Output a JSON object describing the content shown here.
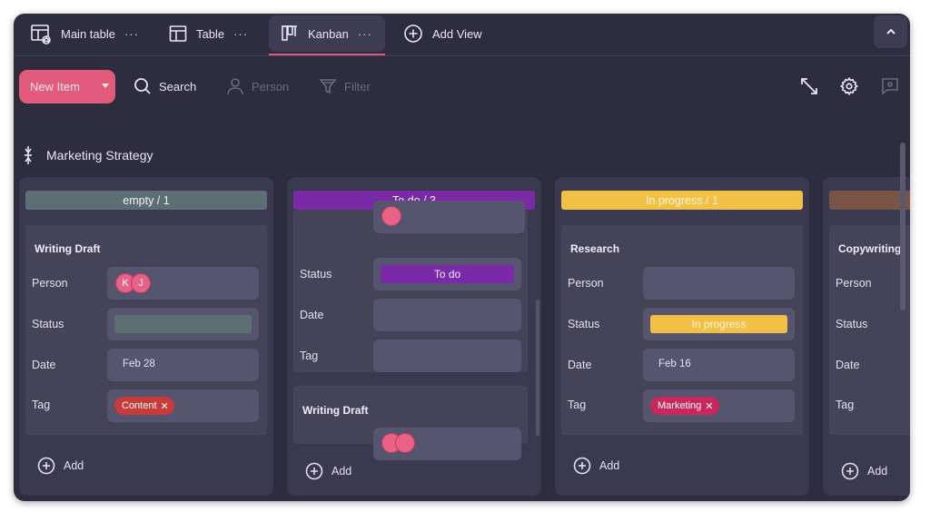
{
  "tabs": [
    {
      "label": "Main table",
      "icon": "table-home-icon",
      "dots": "···"
    },
    {
      "label": "Table",
      "icon": "table-icon",
      "dots": "···"
    },
    {
      "label": "Kanban",
      "icon": "kanban-icon",
      "dots": "···",
      "active": true
    }
  ],
  "add_view": {
    "label": "Add View",
    "icon": "plus-circle-icon"
  },
  "toolbar": {
    "new_item_label": "New Item",
    "search_label": "Search",
    "person_label": "Person",
    "filter_label": "Filter"
  },
  "board": {
    "title": "Marketing Strategy"
  },
  "labels": {
    "person": "Person",
    "status": "Status",
    "date": "Date",
    "tag": "Tag",
    "add": "Add"
  },
  "columns": [
    {
      "header": "empty / 1",
      "header_color": "#5c7073",
      "card": {
        "title": "Writing Draft",
        "avatars": [
          "K",
          "J"
        ],
        "status_color": "#5c7073",
        "date": "Feb 28",
        "tag": "Content",
        "tag_color": "#c93a3a"
      }
    },
    {
      "header": "To do / 3",
      "header_color": "#7a2aa6",
      "card": {
        "status": "To do",
        "status_color": "#7a2aa6"
      },
      "card2": {
        "title": "Writing Draft"
      }
    },
    {
      "header": "In progress / 1",
      "header_color": "#f1c044",
      "card": {
        "title": "Research",
        "status": "In progress",
        "status_color": "#f1c044",
        "date": "Feb 16",
        "tag": "Marketing",
        "tag_color": "#c9275a"
      }
    },
    {
      "header": "",
      "header_color": "#7a5545",
      "card": {
        "title": "Copywriting"
      }
    }
  ],
  "colors": {
    "accent": "#e35b7c",
    "background": "#2e2d3f",
    "column": "#3a394f",
    "card": "#444358",
    "field": "#565570"
  }
}
